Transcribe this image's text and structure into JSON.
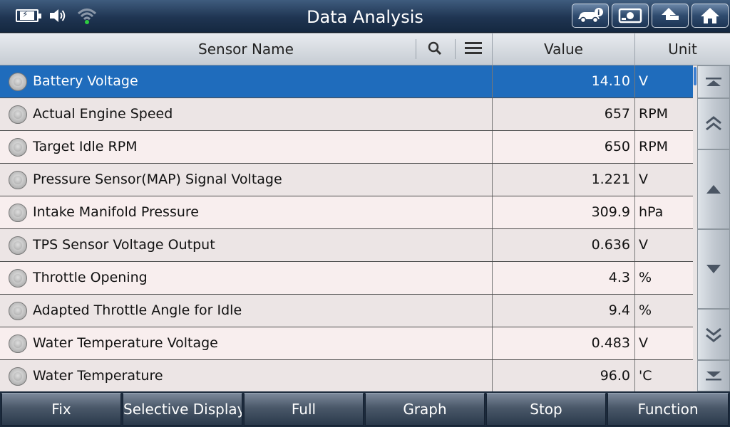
{
  "app": {
    "title": "Data Analysis"
  },
  "status": {
    "icons": [
      "battery-charging-icon",
      "speaker-icon",
      "wifi-icon"
    ]
  },
  "topbar_buttons": [
    "car-info-icon",
    "record-icon",
    "back-arrow-icon",
    "home-icon"
  ],
  "table": {
    "headers": {
      "name": "Sensor Name",
      "value": "Value",
      "unit": "Unit"
    },
    "rows": [
      {
        "name": "Battery Voltage",
        "value": "14.10",
        "unit": "V",
        "selected": true
      },
      {
        "name": "Actual Engine Speed",
        "value": "657",
        "unit": "RPM"
      },
      {
        "name": "Target Idle RPM",
        "value": "650",
        "unit": "RPM"
      },
      {
        "name": "Pressure Sensor(MAP) Signal Voltage",
        "value": "1.221",
        "unit": "V"
      },
      {
        "name": "Intake Manifold Pressure",
        "value": "309.9",
        "unit": "hPa"
      },
      {
        "name": "TPS Sensor Voltage Output",
        "value": "0.636",
        "unit": "V"
      },
      {
        "name": "Throttle Opening",
        "value": "4.3",
        "unit": "%"
      },
      {
        "name": "Adapted Throttle Angle for Idle",
        "value": "9.4",
        "unit": "%"
      },
      {
        "name": "Water Temperature Voltage",
        "value": "0.483",
        "unit": "V"
      },
      {
        "name": "Water Temperature",
        "value": "96.0",
        "unit": "'C"
      }
    ]
  },
  "toolbar": {
    "fix": "Fix",
    "selective_display": "Selective Display",
    "full": "Full",
    "graph": "Graph",
    "stop": "Stop",
    "function": "Function"
  },
  "colors": {
    "selected_row": "#1f6cbc",
    "topbar": "#1f3552",
    "wifi_dot": "#2ecc40"
  }
}
